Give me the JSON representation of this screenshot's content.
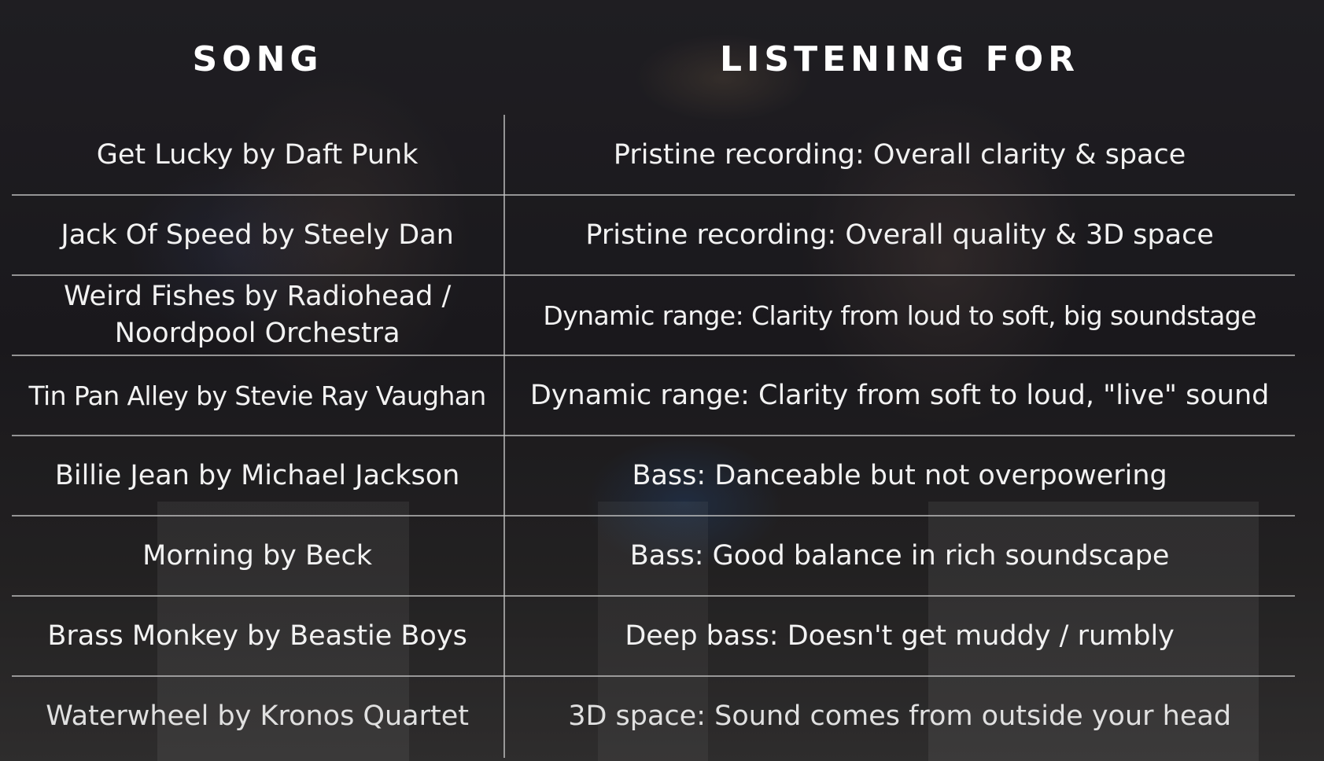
{
  "headers": {
    "song": "SONG",
    "listening_for": "LISTENING FOR"
  },
  "rows": [
    {
      "song": "Get Lucky by Daft Punk",
      "listening_for": "Pristine recording: Overall clarity & space"
    },
    {
      "song": "Jack Of Speed by Steely Dan",
      "listening_for": "Pristine recording: Overall quality & 3D space"
    },
    {
      "song": "Weird Fishes by Radiohead / Noordpool Orchestra",
      "listening_for": "Dynamic range: Clarity from loud to soft, big soundstage"
    },
    {
      "song": "Tin Pan Alley by Stevie Ray Vaughan",
      "listening_for": "Dynamic range: Clarity from soft to loud, \"live\" sound"
    },
    {
      "song": "Billie Jean by Michael Jackson",
      "listening_for": "Bass: Danceable but not overpowering"
    },
    {
      "song": "Morning by Beck",
      "listening_for": "Bass: Good balance in rich soundscape"
    },
    {
      "song": "Brass Monkey by Beastie Boys",
      "listening_for": "Deep bass: Doesn't get muddy / rumbly"
    },
    {
      "song": "Waterwheel by Kronos Quartet",
      "listening_for": "3D space: Sound comes from outside your head"
    }
  ]
}
